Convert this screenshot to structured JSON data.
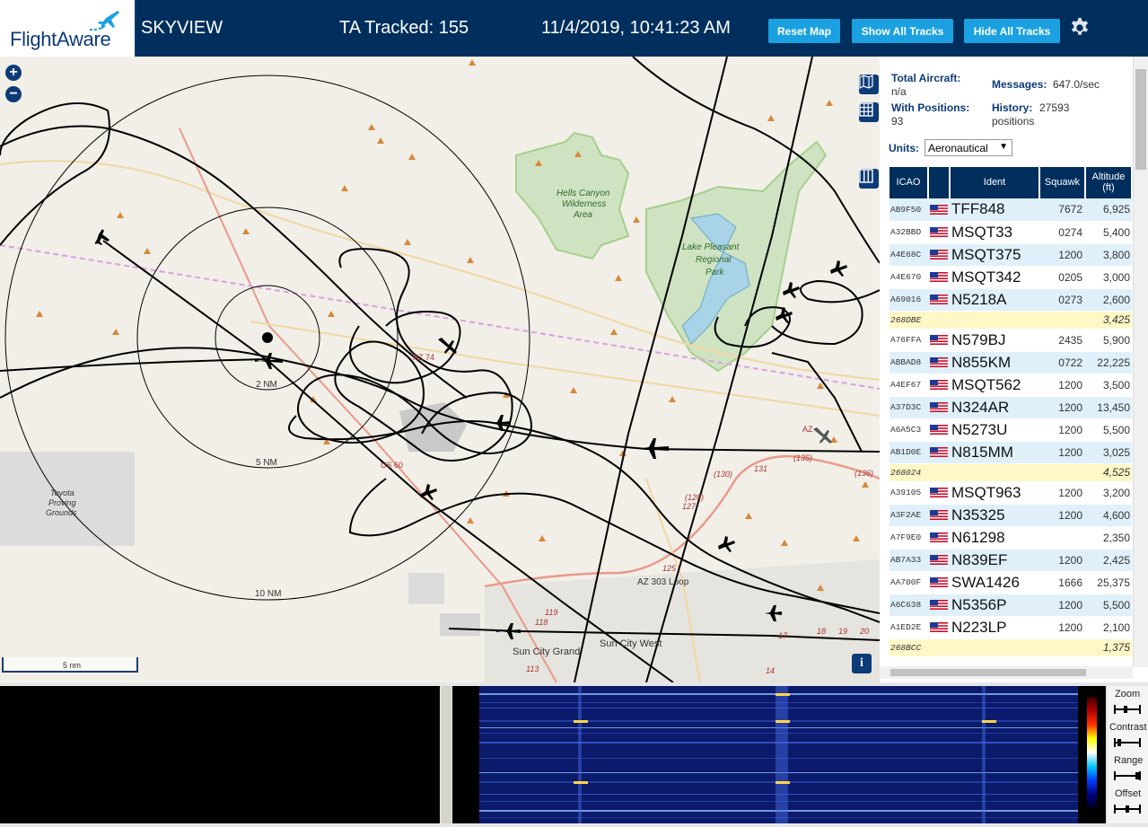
{
  "header": {
    "logo_text": "FlightAware",
    "app_title": "SKYVIEW",
    "tracked_text": "TA Tracked: 155",
    "clock": "11/4/2019, 10:41:23 AM",
    "buttons": {
      "reset": "Reset Map",
      "show_all": "Show All Tracks",
      "hide_all": "Hide All Tracks"
    }
  },
  "map": {
    "zoom_in": "+",
    "zoom_out": "−",
    "scale_label": "5 nm",
    "range_rings": [
      "2 NM",
      "5 NM",
      "10 NM"
    ],
    "labels": {
      "park1_line1": "Hells Canyon",
      "park1_line2": "Wilderness",
      "park1_line3": "Area",
      "park2_line1": "Lake Pleasant",
      "park2_line2": "Regional",
      "park2_line3": "Park",
      "toyota_line1": "Toyota",
      "toyota_line2": "Proving",
      "toyota_line3": "Grounds",
      "sun_city_grand": "Sun City Grand",
      "sun_city_west": "Sun City West",
      "loop": "AZ 303 Loop",
      "us60": "US 60",
      "az74": "AZ 74",
      "az": "AZ",
      "r130": "(130)",
      "r131": "131",
      "r135": "(135)",
      "r136": "(136)",
      "r128": "(128)",
      "r127": "127",
      "r125": "125",
      "r119": "119",
      "r118": "118",
      "r113": "113",
      "r17": "17",
      "r18": "18",
      "r19": "19",
      "r20": "20",
      "r14": "14"
    },
    "info_glyph": "i"
  },
  "stats": {
    "total_aircraft_label": "Total Aircraft:",
    "total_aircraft_value": "n/a",
    "with_positions_label": "With Positions:",
    "with_positions_value": "93",
    "messages_label": "Messages:",
    "messages_value": "647.0/sec",
    "history_label": "History:",
    "history_value": "27593",
    "history_unit": "positions",
    "units_label": "Units:",
    "units_value": "Aeronautical"
  },
  "table": {
    "columns": [
      "ICAO",
      "",
      "Ident",
      "Squawk",
      "Altitude (ft)"
    ],
    "rows": [
      {
        "icao": "AB9F50",
        "ident": "TFF848",
        "squawk": "7672",
        "alt": "6,925",
        "flag": true,
        "ghost": false
      },
      {
        "icao": "A32BBD",
        "ident": "MSQT33",
        "squawk": "0274",
        "alt": "5,400",
        "flag": true,
        "ghost": false
      },
      {
        "icao": "A4E68C",
        "ident": "MSQT375",
        "squawk": "1200",
        "alt": "3,800",
        "flag": true,
        "ghost": false
      },
      {
        "icao": "A4E670",
        "ident": "MSQT342",
        "squawk": "0205",
        "alt": "3,000",
        "flag": true,
        "ghost": false
      },
      {
        "icao": "A69016",
        "ident": "N5218A",
        "squawk": "0273",
        "alt": "2,600",
        "flag": true,
        "ghost": false
      },
      {
        "icao": "268DBE",
        "ident": "",
        "squawk": "",
        "alt": "3,425",
        "flag": false,
        "ghost": true
      },
      {
        "icao": "A76FFA",
        "ident": "N579BJ",
        "squawk": "2435",
        "alt": "5,900",
        "flag": true,
        "ghost": false
      },
      {
        "icao": "ABBAD8",
        "ident": "N855KM",
        "squawk": "0722",
        "alt": "22,225",
        "flag": true,
        "ghost": false
      },
      {
        "icao": "A4EF67",
        "ident": "MSQT562",
        "squawk": "1200",
        "alt": "3,500",
        "flag": true,
        "ghost": false
      },
      {
        "icao": "A37D3C",
        "ident": "N324AR",
        "squawk": "1200",
        "alt": "13,450",
        "flag": true,
        "ghost": false
      },
      {
        "icao": "A6A5C3",
        "ident": "N5273U",
        "squawk": "1200",
        "alt": "5,500",
        "flag": true,
        "ghost": false
      },
      {
        "icao": "AB1D0E",
        "ident": "N815MM",
        "squawk": "1200",
        "alt": "3,025",
        "flag": true,
        "ghost": false
      },
      {
        "icao": "268024",
        "ident": "",
        "squawk": "",
        "alt": "4,525",
        "flag": false,
        "ghost": true
      },
      {
        "icao": "A39105",
        "ident": "MSQT963",
        "squawk": "1200",
        "alt": "3,200",
        "flag": true,
        "ghost": false
      },
      {
        "icao": "A3F2AE",
        "ident": "N35325",
        "squawk": "1200",
        "alt": "4,600",
        "flag": true,
        "ghost": false
      },
      {
        "icao": "A7F9E0",
        "ident": "N61298",
        "squawk": "",
        "alt": "2,350",
        "flag": true,
        "ghost": false
      },
      {
        "icao": "AB7A33",
        "ident": "N839EF",
        "squawk": "1200",
        "alt": "2,425",
        "flag": true,
        "ghost": false
      },
      {
        "icao": "AA700F",
        "ident": "SWA1426",
        "squawk": "1666",
        "alt": "25,375",
        "flag": true,
        "ghost": false
      },
      {
        "icao": "A6C638",
        "ident": "N5356P",
        "squawk": "1200",
        "alt": "5,500",
        "flag": true,
        "ghost": false
      },
      {
        "icao": "A1ED2E",
        "ident": "N223LP",
        "squawk": "1200",
        "alt": "2,100",
        "flag": true,
        "ghost": false
      },
      {
        "icao": "268BCC",
        "ident": "",
        "squawk": "",
        "alt": "1,375",
        "flag": false,
        "ghost": true
      }
    ]
  },
  "waterfall_controls": {
    "zoom": "Zoom",
    "contrast": "Contrast",
    "range": "Range",
    "offset": "Offset"
  },
  "colors": {
    "header_bg": "#002f5d",
    "button_bg": "#1ba1e2",
    "map_bg": "#f1efe8",
    "table_header": "#002f5d",
    "row_alt": "#dff0fa",
    "ghost_row": "#fff7c6"
  }
}
